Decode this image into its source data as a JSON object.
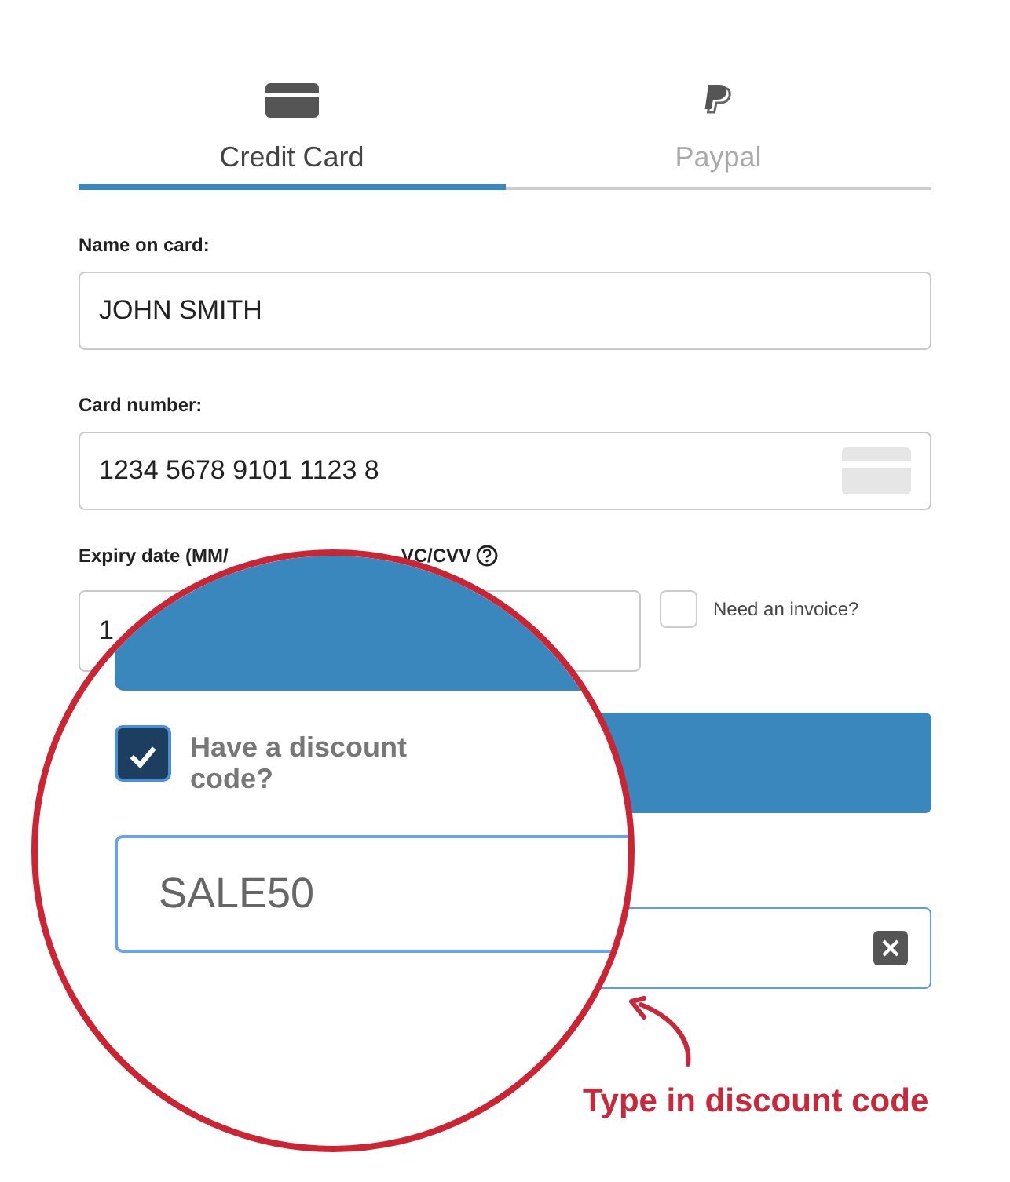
{
  "tabs": [
    {
      "label": "Credit Card",
      "kind": "card",
      "selected": true
    },
    {
      "label": "Paypal",
      "kind": "paypal",
      "selected": false
    }
  ],
  "name_field": {
    "label": "Name on card:",
    "value": "JOHN SMITH"
  },
  "card_field": {
    "label": "Card number:",
    "value": "1234 5678 9101 1123 8"
  },
  "expiry_field": {
    "label": "Expiry date (MM/",
    "value": "1"
  },
  "cvc_label": "VC/CVV",
  "invoice": {
    "label": "Need an invoice?",
    "checked": false
  },
  "magnifier": {
    "discount": {
      "label": "Have a discount code?",
      "checked": true
    },
    "code_field": {
      "value": "SALE50"
    }
  },
  "annotation": "Type in discount code"
}
